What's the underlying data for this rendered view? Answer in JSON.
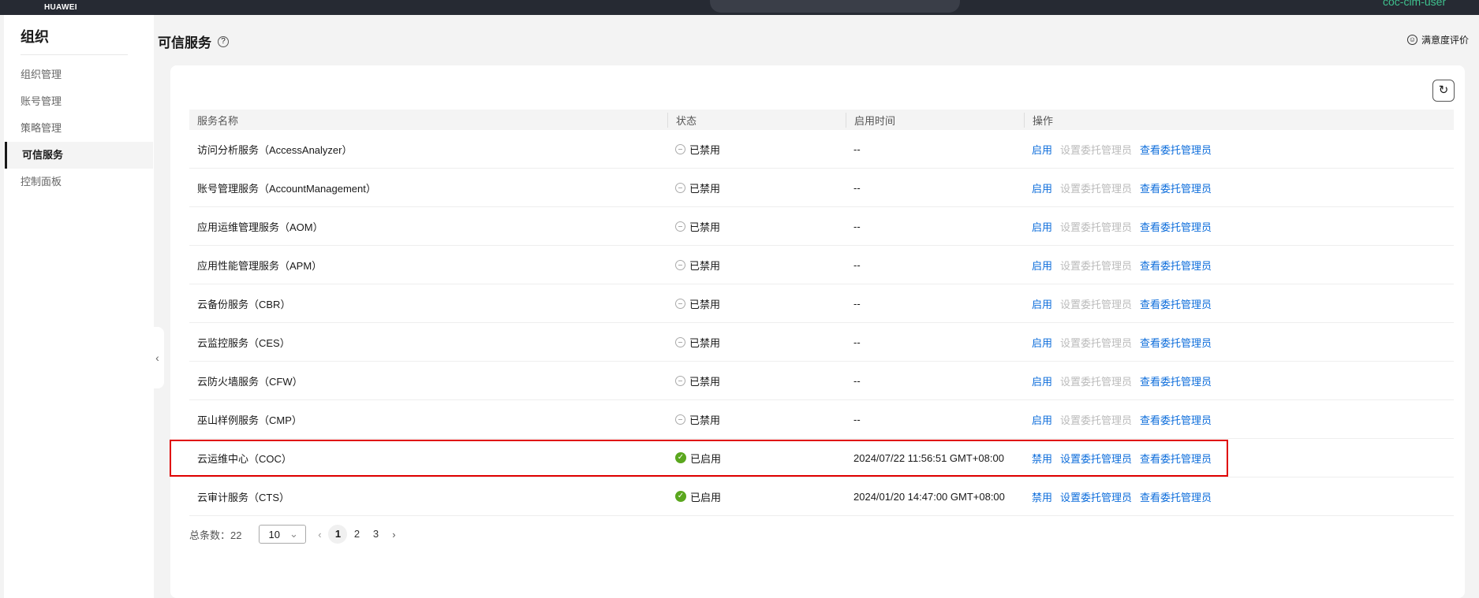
{
  "topbar": {
    "logo": "HUAWEI",
    "user": "coc-cim-user"
  },
  "sidebar": {
    "title": "组织",
    "items": [
      {
        "label": "组织管理"
      },
      {
        "label": "账号管理"
      },
      {
        "label": "策略管理"
      },
      {
        "label": "可信服务",
        "active": true
      },
      {
        "label": "控制面板"
      }
    ]
  },
  "page": {
    "title": "可信服务",
    "help": "?",
    "rate": "满意度评价"
  },
  "table": {
    "headers": [
      "服务名称",
      "状态",
      "启用时间",
      "操作"
    ],
    "rows": [
      {
        "name": "访问分析服务（AccessAnalyzer）",
        "status": "已禁用",
        "time": "--",
        "action": "启用",
        "set": "设置委托管理员",
        "view": "查看委托管理员",
        "enabled": false
      },
      {
        "name": "账号管理服务（AccountManagement）",
        "status": "已禁用",
        "time": "--",
        "action": "启用",
        "set": "设置委托管理员",
        "view": "查看委托管理员",
        "enabled": false
      },
      {
        "name": "应用运维管理服务（AOM）",
        "status": "已禁用",
        "time": "--",
        "action": "启用",
        "set": "设置委托管理员",
        "view": "查看委托管理员",
        "enabled": false
      },
      {
        "name": "应用性能管理服务（APM）",
        "status": "已禁用",
        "time": "--",
        "action": "启用",
        "set": "设置委托管理员",
        "view": "查看委托管理员",
        "enabled": false
      },
      {
        "name": "云备份服务（CBR）",
        "status": "已禁用",
        "time": "--",
        "action": "启用",
        "set": "设置委托管理员",
        "view": "查看委托管理员",
        "enabled": false
      },
      {
        "name": "云监控服务（CES）",
        "status": "已禁用",
        "time": "--",
        "action": "启用",
        "set": "设置委托管理员",
        "view": "查看委托管理员",
        "enabled": false
      },
      {
        "name": "云防火墙服务（CFW）",
        "status": "已禁用",
        "time": "--",
        "action": "启用",
        "set": "设置委托管理员",
        "view": "查看委托管理员",
        "enabled": false
      },
      {
        "name": "巫山样例服务（CMP）",
        "status": "已禁用",
        "time": "--",
        "action": "启用",
        "set": "设置委托管理员",
        "view": "查看委托管理员",
        "enabled": false
      },
      {
        "name": "云运维中心（COC）",
        "status": "已启用",
        "time": "2024/07/22 11:56:51 GMT+08:00",
        "action": "禁用",
        "set": "设置委托管理员",
        "view": "查看委托管理员",
        "enabled": true
      },
      {
        "name": "云审计服务（CTS）",
        "status": "已启用",
        "time": "2024/01/20 14:47:00 GMT+08:00",
        "action": "禁用",
        "set": "设置委托管理员",
        "view": "查看委托管理员",
        "enabled": true
      }
    ]
  },
  "pagination": {
    "total_label": "总条数：22",
    "page_size": "10",
    "pages": [
      "1",
      "2",
      "3"
    ],
    "current": "1"
  },
  "colors": {
    "link": "#0d6ddb",
    "enabled": "#5aa71e",
    "highlight": "#e00000"
  }
}
